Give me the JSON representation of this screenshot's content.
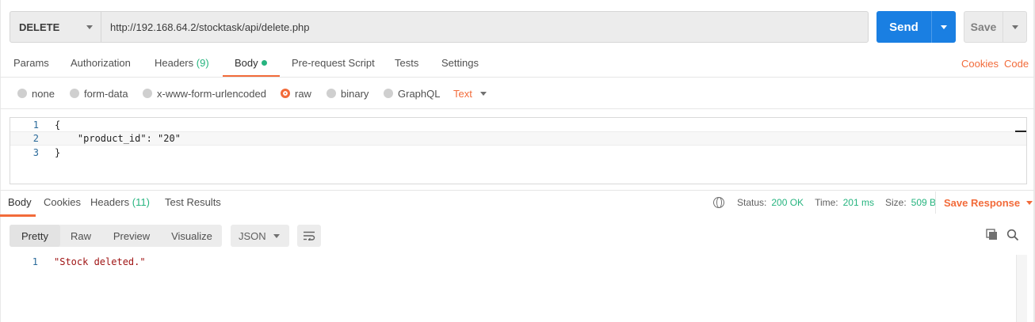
{
  "request": {
    "method": "DELETE",
    "url": "http://192.168.64.2/stocktask/api/delete.php",
    "send_label": "Send",
    "save_label": "Save"
  },
  "request_tabs": {
    "params": "Params",
    "authorization": "Authorization",
    "headers": "Headers",
    "headers_count": "(9)",
    "body": "Body",
    "pre_request": "Pre-request Script",
    "tests": "Tests",
    "settings": "Settings",
    "cookies_link": "Cookies",
    "code_link": "Code"
  },
  "body_types": {
    "none": "none",
    "form_data": "form-data",
    "urlencoded": "x-www-form-urlencoded",
    "raw": "raw",
    "binary": "binary",
    "graphql": "GraphQL",
    "text_type": "Text",
    "selected": "raw"
  },
  "editor": {
    "lines": [
      {
        "n": "1",
        "code": "{"
      },
      {
        "n": "2",
        "code": "    \"product_id\": \"20\""
      },
      {
        "n": "3",
        "code": "}"
      }
    ]
  },
  "response_tabs": {
    "body": "Body",
    "cookies": "Cookies",
    "headers": "Headers",
    "headers_count": "(11)",
    "test_results": "Test Results"
  },
  "status": {
    "status_label": "Status:",
    "status_value": "200 OK",
    "time_label": "Time:",
    "time_value": "201 ms",
    "size_label": "Size:",
    "size_value": "509 B",
    "save_response": "Save Response"
  },
  "response_view": {
    "pretty": "Pretty",
    "raw": "Raw",
    "preview": "Preview",
    "visualize": "Visualize",
    "format": "JSON"
  },
  "response_body": {
    "lines": [
      {
        "n": "1",
        "code": "\"Stock deleted.\""
      }
    ]
  },
  "colors": {
    "accent": "#f26b3a",
    "send_blue": "#1a7fe2",
    "success_green": "#26b47f"
  }
}
